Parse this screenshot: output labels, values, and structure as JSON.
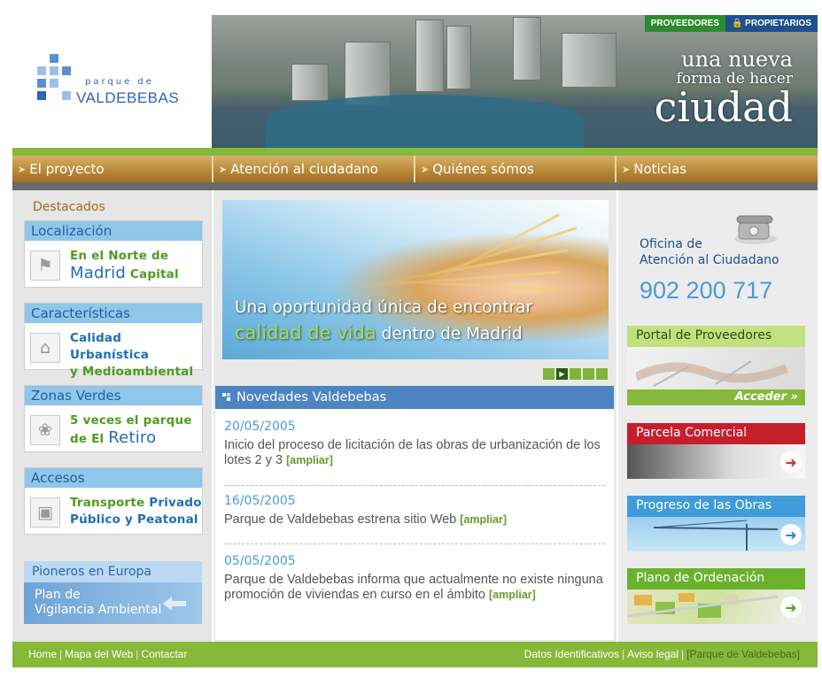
{
  "header": {
    "logo_top": "parque de",
    "logo_name": "VALDEBEBAS",
    "hero_line1": "una nueva",
    "hero_line2": "forma de hacer",
    "hero_line3": "ciudad",
    "top_links": [
      "PROVEEDORES",
      "PROPIETARIOS"
    ]
  },
  "nav": {
    "items": [
      "El proyecto",
      "Atención al ciudadano",
      "Quiénes sómos",
      "Noticias"
    ]
  },
  "left": {
    "section_title": "Destacados",
    "boxes": [
      {
        "title": "Localización",
        "line1": "En el Norte de",
        "line2a": "Madrid",
        "line2b": "Capital",
        "icon": "map-icon"
      },
      {
        "title": "Características",
        "line1": "Calidad Urbanística",
        "line2": "y Medioambiental",
        "icon": "house-icon"
      },
      {
        "title": "Zonas Verdes",
        "line1": "5 veces el parque",
        "line2a": "de El",
        "line2b": "Retiro",
        "icon": "tree-icon"
      },
      {
        "title": "Accesos",
        "line1a": "Transporte",
        "line1b": "Privado",
        "line2a": "Público",
        "line2b": "y Peatonal",
        "icon": "bus-icon"
      }
    ],
    "pioneros": {
      "title": "Pioneros en Europa",
      "line1": "Plan de",
      "line2": "Vigilancia Ambiental"
    }
  },
  "banner": {
    "line1": "Una oportunidad única de encontrar",
    "highlight": "calidad de vida",
    "line2_rest": "dentro de Madrid"
  },
  "news": {
    "title": "Novedades Valdebebas",
    "more_label": "[ampliar]",
    "items": [
      {
        "date": "20/05/2005",
        "text": "Inicio del proceso de licitación de las obras de urbanización de los lotes 2 y 3"
      },
      {
        "date": "16/05/2005",
        "text": "Parque de Valdebebas estrena sitio Web"
      },
      {
        "date": "05/05/2005",
        "text": "Parque de Valdebebas informa que actualmente no existe ninguna promoción de viviendas en curso en el ámbito"
      }
    ]
  },
  "right": {
    "oficina_l1": "Oficina de",
    "oficina_l2": "Atención al Ciudadano",
    "phone": "902 200 717",
    "portal_title": "Portal de Proveedores",
    "portal_access": "Acceder",
    "parcela_title": "Parcela Comercial",
    "progreso_title": "Progreso de las Obras",
    "plano_title": "Plano de Ordenación"
  },
  "footer": {
    "left_links": [
      "Home",
      "Mapa del Web",
      "Contactar"
    ],
    "right_links": [
      "Datos Identificativos",
      "Aviso legal"
    ],
    "brand": "[Parque de Valdebebas]"
  },
  "colors": {
    "accent_green": "#86b83a",
    "nav_gold": "#b98a38",
    "brand_blue": "#1e6fb5"
  }
}
